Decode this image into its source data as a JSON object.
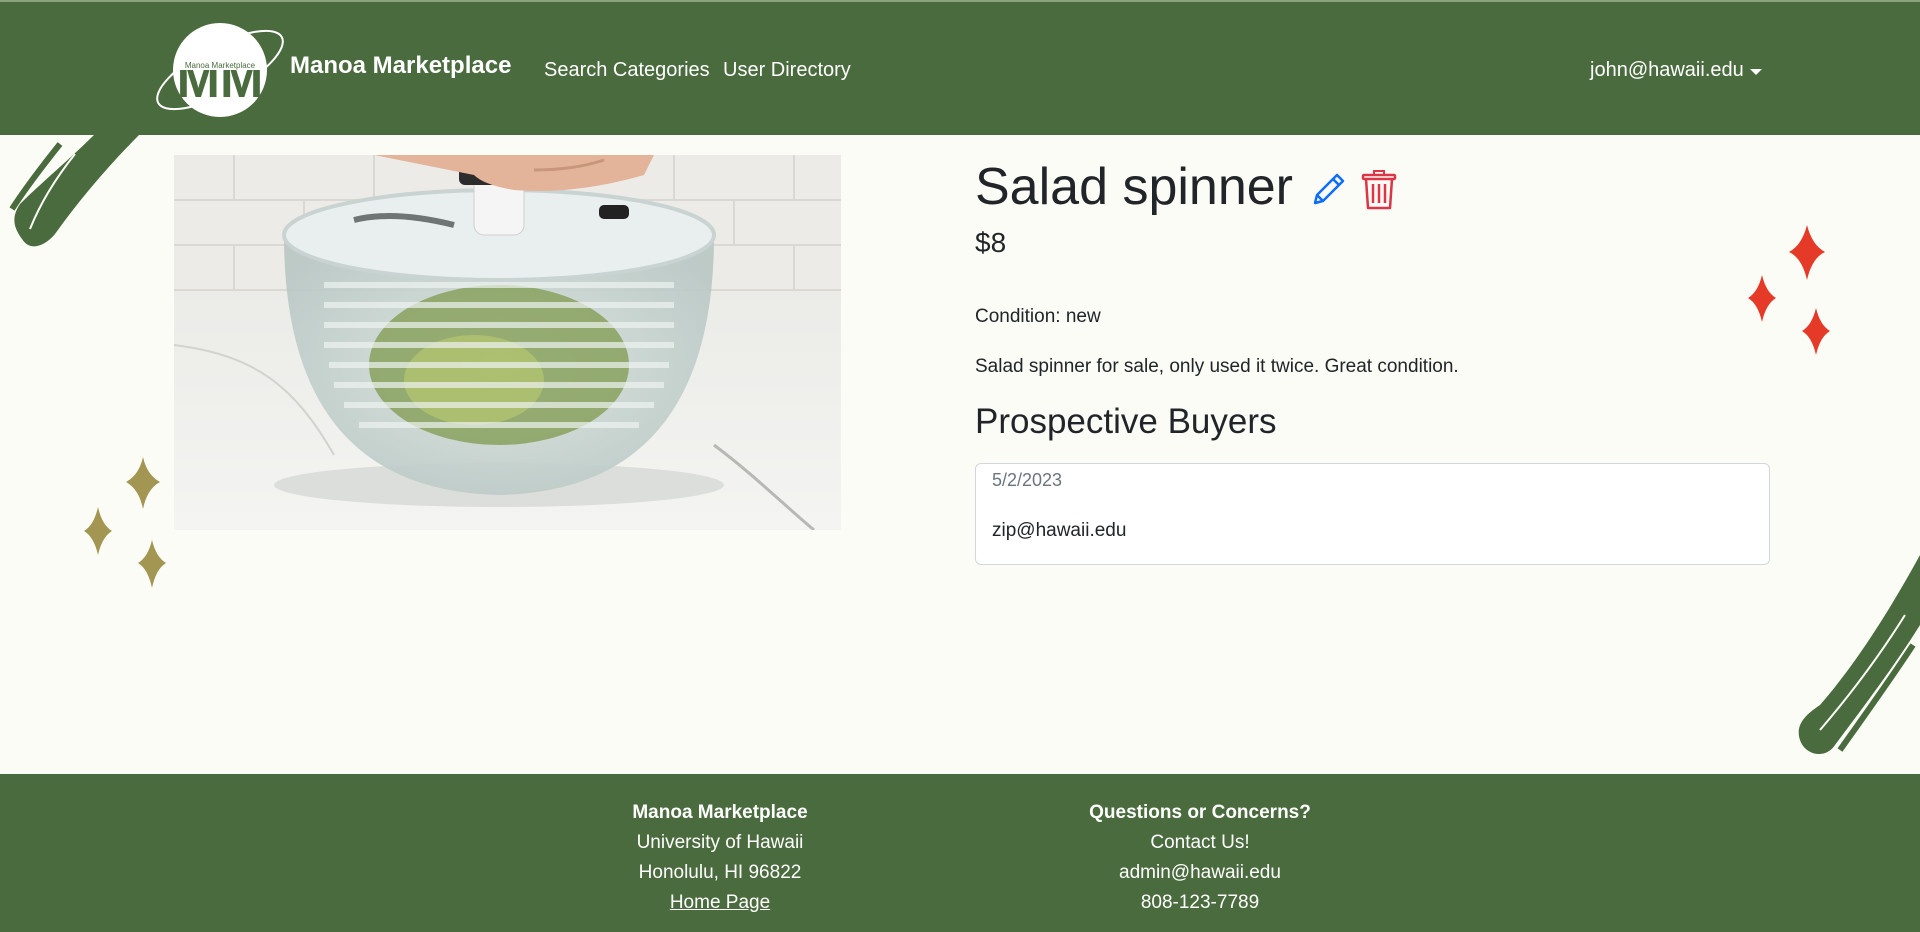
{
  "header": {
    "logo_text": "Manoa Marketplace",
    "logo_letters": "MM",
    "brand": "Manoa Marketplace",
    "nav": [
      {
        "label": "Search Categories"
      },
      {
        "label": "User Directory"
      }
    ],
    "user_email": "john@hawaii.edu"
  },
  "item": {
    "title": "Salad spinner",
    "price": "$8",
    "condition": "Condition: new",
    "description": "Salad spinner for sale, only used it twice. Great condition."
  },
  "buyers": {
    "heading": "Prospective Buyers",
    "list": [
      {
        "date": "5/2/2023",
        "email": "zip@hawaii.edu"
      }
    ]
  },
  "footer": {
    "col1": {
      "title": "Manoa Marketplace",
      "line1": "University of Hawaii",
      "line2": "Honolulu, HI 96822",
      "link": "Home Page"
    },
    "col2": {
      "title": "Questions or Concerns?",
      "line1": "Contact Us!",
      "line2": "admin@hawaii.edu",
      "line3": "808-123-7789"
    }
  },
  "colors": {
    "brand_green": "#4a6b3e",
    "background": "#fcfcf6",
    "edit_blue": "#0d6efd",
    "delete_red": "#dc3545",
    "sparkle_red": "#e63a28",
    "sparkle_gold": "#a39552"
  },
  "icons": {
    "edit": "pencil-icon",
    "delete": "trash-icon",
    "user_menu": "caret-down-icon"
  }
}
